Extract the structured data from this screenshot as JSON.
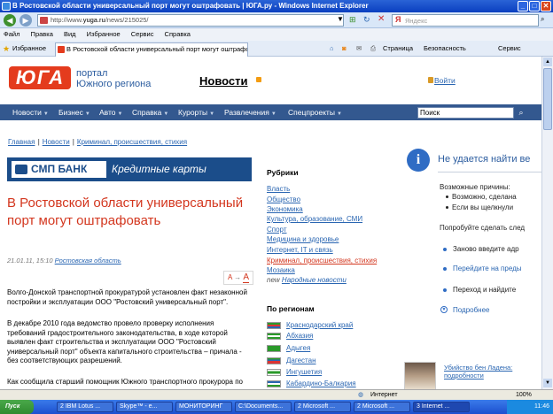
{
  "window": {
    "title": "В Ростовской области универсальный порт могут оштрафовать | ЮГА.ру - Windows Internet Explorer",
    "min": "_",
    "max": "□",
    "close": "✕"
  },
  "address": {
    "url_prefix": "http://www.",
    "url_host": "yuga.ru",
    "url_path": "/news/215025/",
    "search_placeholder": "Яндекс"
  },
  "menu": [
    "Файл",
    "Правка",
    "Вид",
    "Избранное",
    "Сервис",
    "Справка"
  ],
  "favorites": {
    "label": "Избранное",
    "tab_title": "В Ростовской области универсальный порт могут оштрафовать...",
    "tools": [
      "Страница",
      "Безопасность",
      "Сервис"
    ]
  },
  "site": {
    "logo": "ЮГА",
    "portal_line1": "портал",
    "portal_line2": "Южного региона",
    "section_title": "Новости",
    "login": "Войти",
    "nav": [
      "Новости",
      "Бизнес",
      "Авто",
      "Справка",
      "Курорты",
      "Развлечения",
      "Спецпроекты"
    ],
    "search_value": "Поиск"
  },
  "breadcrumb": [
    "Главная",
    "Новости",
    "Криминал, происшествия, стихия"
  ],
  "banner": {
    "bank": "СМП БАНК",
    "caption": "Кредитные карты"
  },
  "article": {
    "headline": "В Ростовской области универсальный порт могут оштрафовать",
    "date": "21.01.11, 15:10",
    "region": "Ростовская область",
    "font_a": "A",
    "font_arrow": "→",
    "paragraphs": [
      "Волго-Донской транспортной прокуратурой установлен факт незаконной постройки и эксплуатации ООО \"Ростовский универсальный порт\".",
      "В декабре 2010 года ведомство провело проверку исполнения требований градостроительного законодательства, в ходе которой выявлен факт строительства и эксплуатации ООО \"Ростовский универсальный порт\" объекта капитального строительства – причала - без соответствующих разрешений.",
      "Как сообщила старший помощник Южного транспортного прокурора по"
    ]
  },
  "rubrics": {
    "heading": "Рубрики",
    "items": [
      "Власть",
      "Общество",
      "Экономика",
      "Культура, образование, СМИ",
      "Спорт",
      "Медицина и здоровье",
      "Интернет, IT и связь",
      "Криминал, происшествия, стихия",
      "Мозаика"
    ],
    "new_label": "new",
    "new_item": "Народные новости"
  },
  "regions": {
    "heading": "По регионам",
    "items": [
      "Краснодарский край",
      "Абхазия",
      "Адыгея",
      "Дагестан",
      "Ингушетия",
      "Кабардино-Балкария"
    ]
  },
  "ie_error": {
    "title": "Не удается найти ве",
    "causes_label": "Возможные причины:",
    "causes": [
      "Возможно, сделана",
      "Если вы щелкнули"
    ],
    "try_label": "Попробуйте сделать след",
    "actions": [
      "Заново введите адр",
      "Перейдите на преды",
      "Переход и найдите"
    ],
    "more": "Подробнее"
  },
  "sidebar_news": "Убийство бен Ладена: подробности",
  "status": {
    "zone": "Интернет",
    "zoom": "100%"
  },
  "taskbar": {
    "start": "Пуск",
    "tasks": [
      "2 IBM Lotus ...",
      "Skype™ - e...",
      "МОНИТОРИНГ",
      "C:\\Documents...",
      "2 Microsoft ...",
      "2 Microsoft ...",
      "3 Internet ..."
    ],
    "clock": "11:46"
  },
  "colors": {
    "accent": "#d3361e",
    "link": "#2a66b2",
    "nav": "#33588f"
  }
}
